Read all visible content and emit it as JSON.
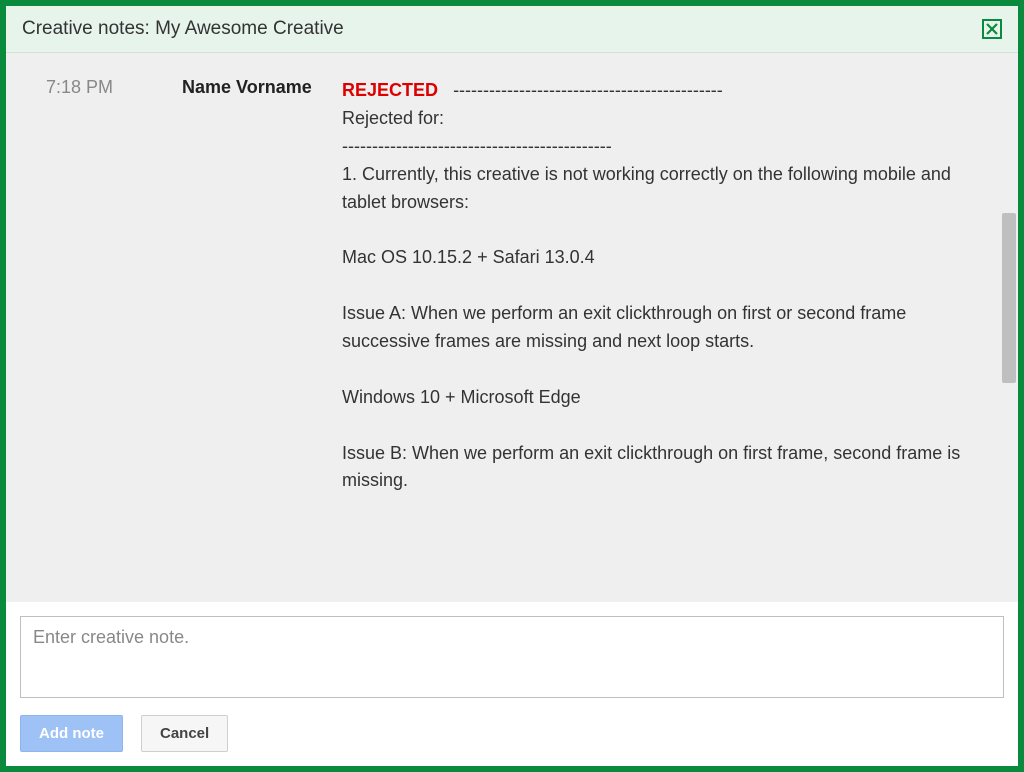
{
  "header": {
    "title": "Creative notes: My Awesome Creative"
  },
  "note": {
    "time": "7:18 PM",
    "author": "Name Vorname",
    "status": "REJECTED",
    "dashes1": "---------------------------------------------",
    "rejected_for": "Rejected for:",
    "dashes2": "---------------------------------------------",
    "line1": "1. Currently, this creative is not working correctly on the following mobile and tablet browsers:",
    "env1": "Mac OS 10.15.2 + Safari 13.0.4",
    "issueA": "Issue A: When we perform an exit clickthrough on first or second frame successive frames are missing and next loop starts.",
    "env2": "Windows 10 + Microsoft Edge",
    "issueB": "Issue B: When we perform an exit clickthrough on first frame, second frame is missing."
  },
  "input": {
    "placeholder": "Enter creative note."
  },
  "buttons": {
    "add": "Add note",
    "cancel": "Cancel"
  }
}
